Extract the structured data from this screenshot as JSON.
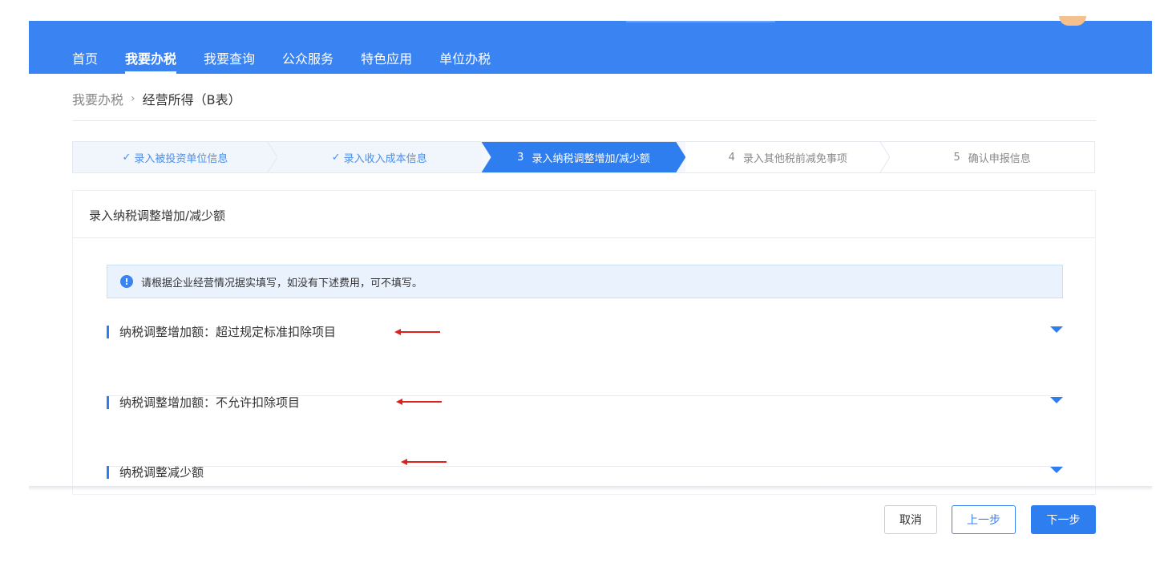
{
  "nav": {
    "items": [
      {
        "label": "首页",
        "active": false
      },
      {
        "label": "我要办税",
        "active": true
      },
      {
        "label": "我要查询",
        "active": false
      },
      {
        "label": "公众服务",
        "active": false
      },
      {
        "label": "特色应用",
        "active": false
      },
      {
        "label": "单位办税",
        "active": false
      }
    ]
  },
  "breadcrumb": {
    "root": "我要办税",
    "separator": "›",
    "current": "经营所得（B表）"
  },
  "steps": [
    {
      "label": "录入被投资单位信息",
      "state": "done"
    },
    {
      "label": "录入收入成本信息",
      "state": "done"
    },
    {
      "number": "3",
      "label": "录入纳税调整增加/减少额",
      "state": "active"
    },
    {
      "number": "4",
      "label": "录入其他税前减免事项",
      "state": "todo"
    },
    {
      "number": "5",
      "label": "确认申报信息",
      "state": "todo"
    }
  ],
  "panel": {
    "title": "录入纳税调整增加/减少额",
    "notice": "请根据企业经营情况据实填写，如没有下述费用，可不填写。",
    "sections": [
      {
        "label": "纳税调整增加额：超过规定标准扣除项目"
      },
      {
        "label": "纳税调整增加额：不允许扣除项目"
      },
      {
        "label": "纳税调整减少额"
      }
    ]
  },
  "buttons": {
    "cancel": "取消",
    "prev": "上一步",
    "next": "下一步"
  },
  "colors": {
    "primary": "#3a83f2",
    "annotation_arrow": "#e0201e"
  }
}
